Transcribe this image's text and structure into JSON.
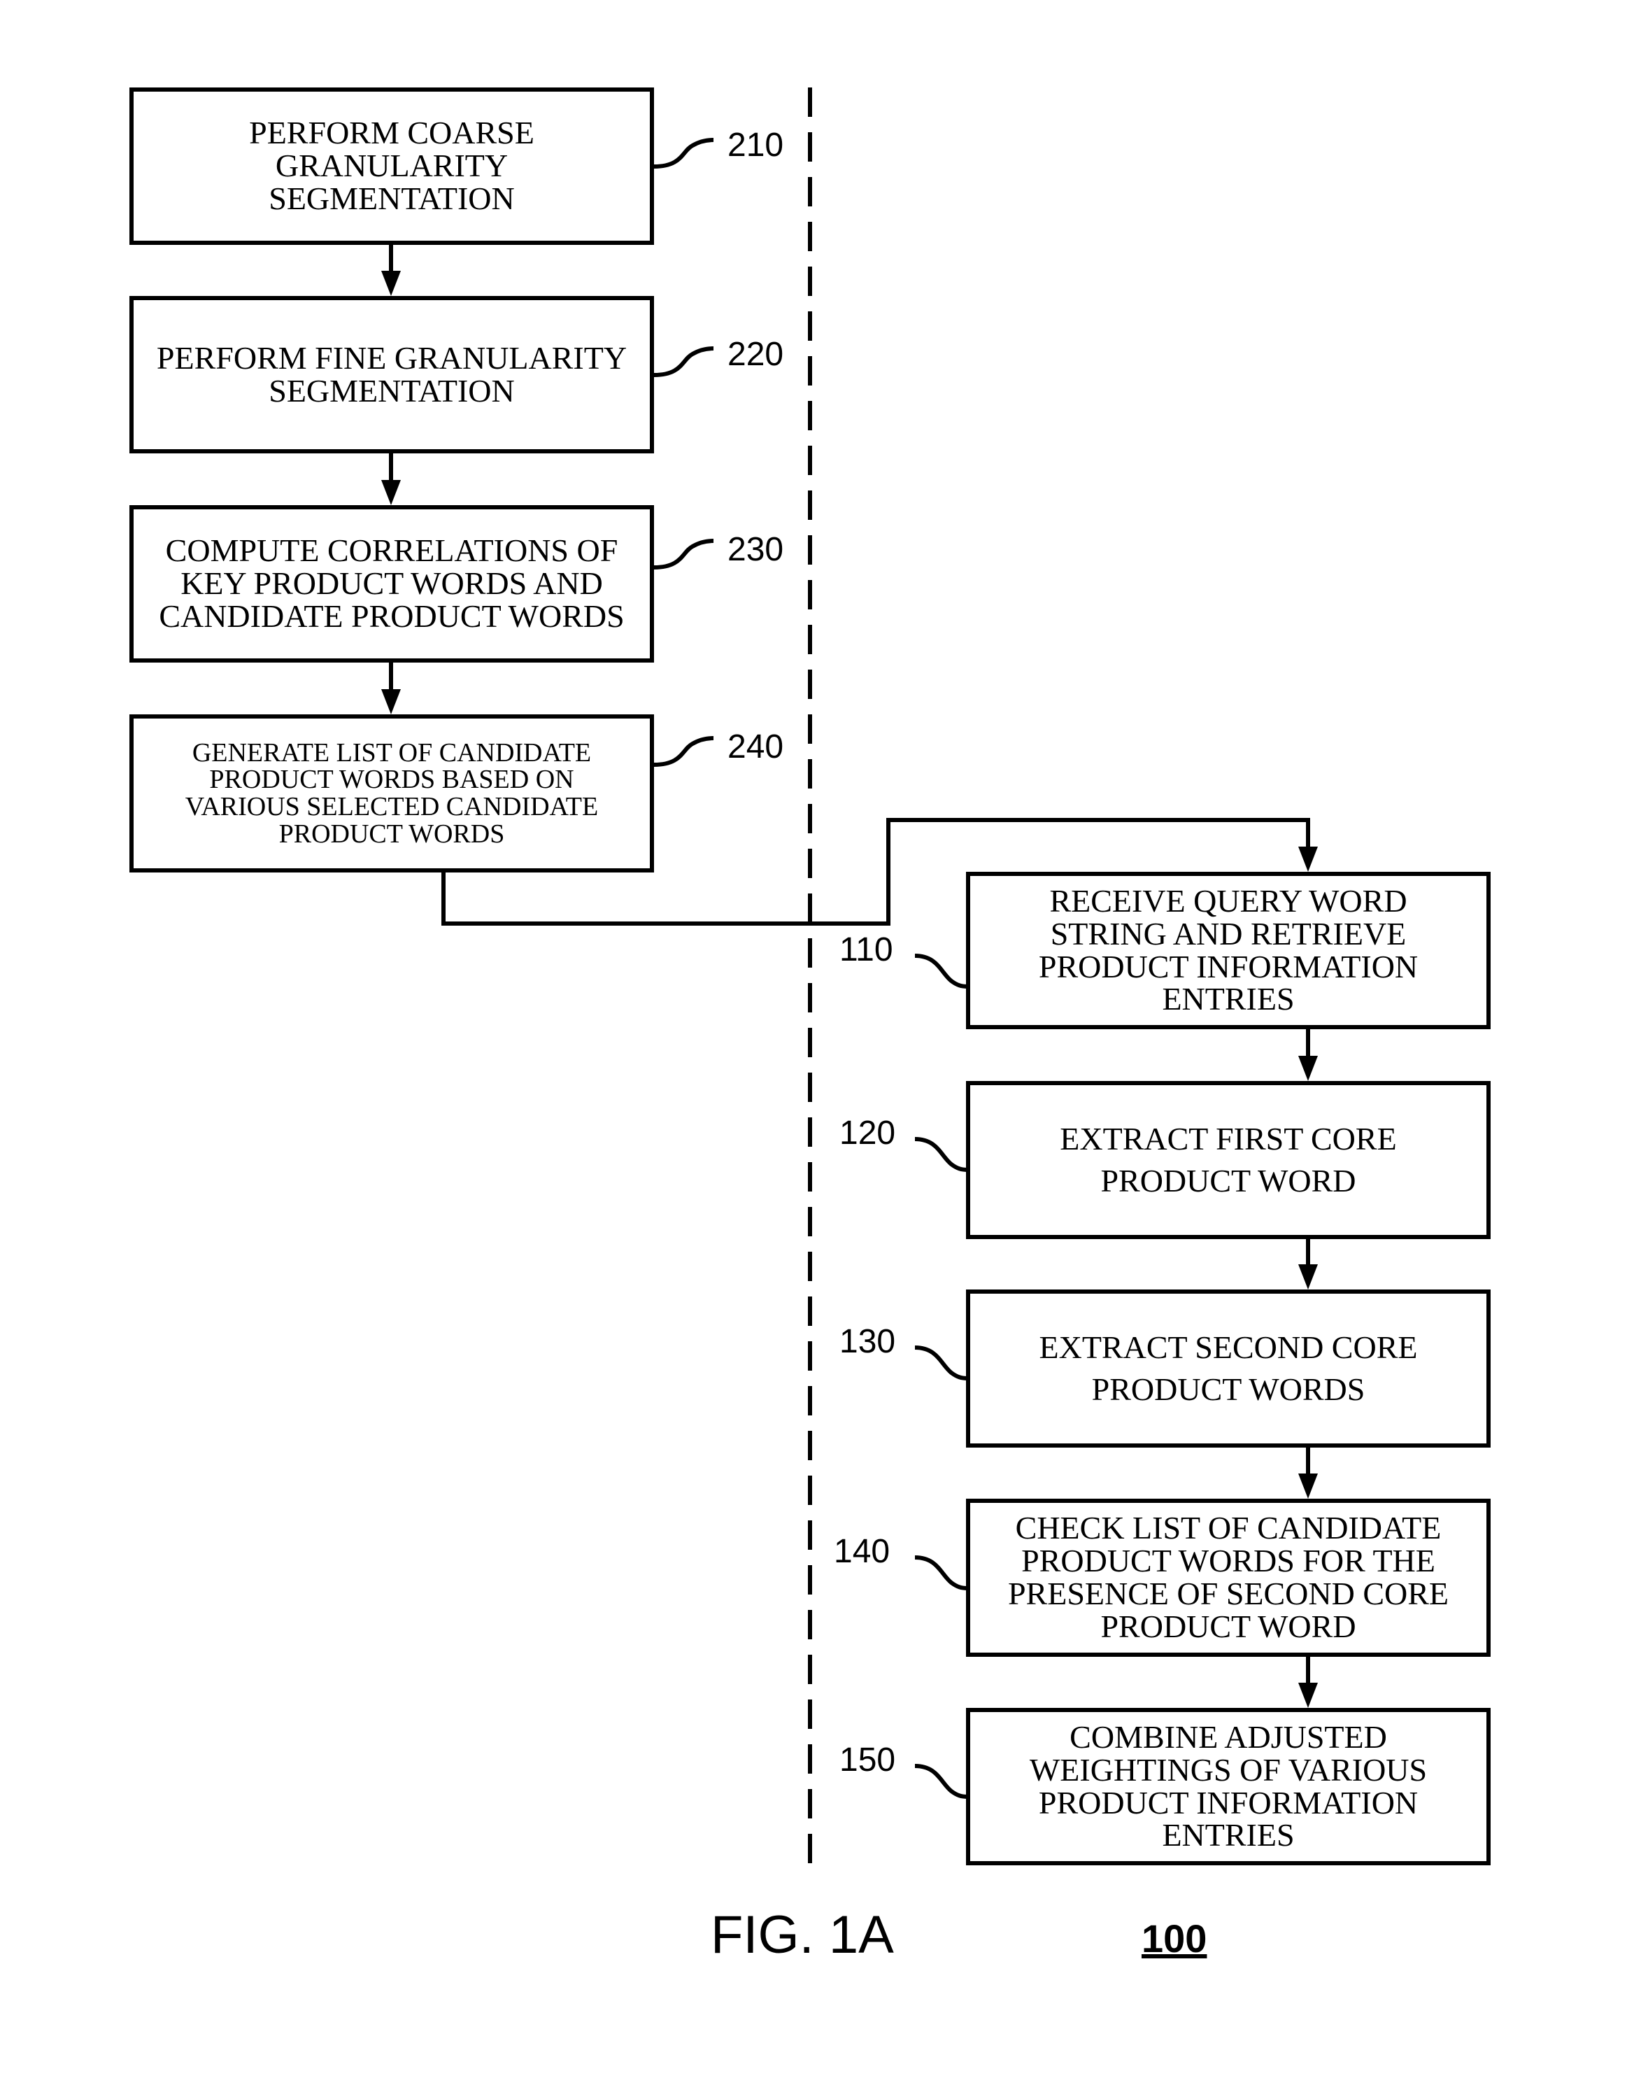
{
  "figure": {
    "caption": "FIG. 1A",
    "reference": "100"
  },
  "left_flow": [
    {
      "id": "210",
      "text": "PERFORM COARSE\nGRANULARITY\nSEGMENTATION"
    },
    {
      "id": "220",
      "text": "PERFORM FINE GRANULARITY\nSEGMENTATION"
    },
    {
      "id": "230",
      "text": "COMPUTE CORRELATIONS OF\nKEY PRODUCT WORDS AND\nCANDIDATE PRODUCT WORDS"
    },
    {
      "id": "240",
      "text": "GENERATE LIST OF CANDIDATE\nPRODUCT WORDS BASED ON\nVARIOUS SELECTED CANDIDATE\nPRODUCT WORDS"
    }
  ],
  "right_flow": [
    {
      "id": "110",
      "text": "RECEIVE QUERY WORD\nSTRING AND RETRIEVE\nPRODUCT INFORMATION\nENTRIES"
    },
    {
      "id": "120",
      "text": "EXTRACT FIRST CORE\nPRODUCT WORD"
    },
    {
      "id": "130",
      "text": "EXTRACT SECOND CORE\nPRODUCT WORDS"
    },
    {
      "id": "140",
      "text": "CHECK LIST OF CANDIDATE\nPRODUCT WORDS FOR THE\nPRESENCE OF SECOND CORE\nPRODUCT WORD"
    },
    {
      "id": "150",
      "text": "COMBINE ADJUSTED\nWEIGHTINGS OF VARIOUS\nPRODUCT INFORMATION\nENTRIES"
    }
  ]
}
